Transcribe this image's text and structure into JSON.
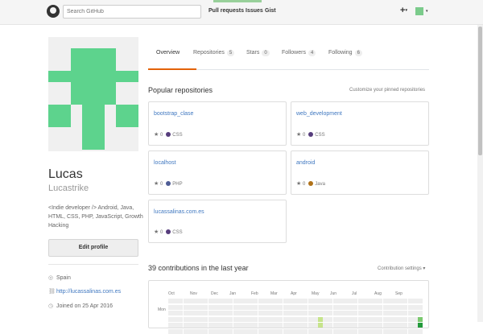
{
  "header": {
    "search_placeholder": "Search GitHub",
    "nav": [
      "Pull requests",
      "Issues",
      "Gist"
    ],
    "plus": "+",
    "caret": "▾"
  },
  "profile": {
    "name": "Lucas",
    "login": "Lucastrike",
    "bio": "<Indie developer /> Android, Java, HTML, CSS, PHP, JavaScript, Growth Hacking",
    "edit_label": "Edit profile",
    "location": "Spain",
    "website": "http://lucassalinas.com.es",
    "joined": "Joined on 25 Apr 2016"
  },
  "tabs": [
    {
      "label": "Overview",
      "count": null
    },
    {
      "label": "Repositories",
      "count": "5"
    },
    {
      "label": "Stars",
      "count": "0"
    },
    {
      "label": "Followers",
      "count": "4"
    },
    {
      "label": "Following",
      "count": "6"
    }
  ],
  "popular": {
    "title": "Popular repositories",
    "customize": "Customize your pinned repositories",
    "repos": [
      {
        "name": "bootstrap_clase",
        "stars": "0",
        "lang": "CSS",
        "color": "#563d7c"
      },
      {
        "name": "web_development",
        "stars": "0",
        "lang": "CSS",
        "color": "#563d7c"
      },
      {
        "name": "localhost",
        "stars": "0",
        "lang": "PHP",
        "color": "#4F5D95"
      },
      {
        "name": "android",
        "stars": "0",
        "lang": "Java",
        "color": "#b07219"
      },
      {
        "name": "lucassalinas.com.es",
        "stars": "0",
        "lang": "CSS",
        "color": "#563d7c"
      }
    ]
  },
  "contributions": {
    "title": "39 contributions in the last year",
    "settings": "Contribution settings ▾",
    "months": [
      "Oct",
      "Nov",
      "Dec",
      "Jan",
      "Feb",
      "Mar",
      "Apr",
      "May",
      "Jun",
      "Jul",
      "Aug",
      "Sep"
    ],
    "day_label": "Mon"
  },
  "icons": {
    "location": "◎",
    "link": "🔗",
    "clock": "◷",
    "star": "★"
  }
}
